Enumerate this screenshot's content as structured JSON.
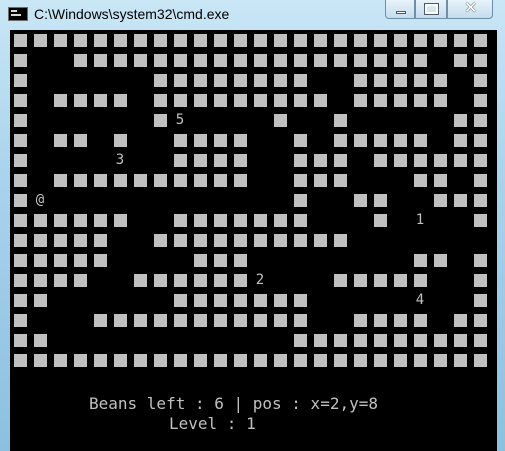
{
  "window": {
    "title": "C:\\Windows\\system32\\cmd.exe",
    "icon": "console-icon",
    "controls": [
      "minimize-icon",
      "maximize-icon",
      "close-icon"
    ]
  },
  "game": {
    "maze_rows": [
      "########################",
      "#  ################## ##",
      "#      ########  ##### ##",
      "# #### ######### ##### ##",
      "#      #5    #  #     ##",
      "# ## #  ####  # ##### ##",
      "#    3  ####  ### ########",
      "# ##########  ###   ## ##",
      "#@            #  ##  ####",
      "######  #######   # 1  # #",
      "#####  ##########        #",
      "#####    ###        ## ##",
      "####  ######2   #####  ##",
      "##      #######     4  ##",
      "#   ###########  #### ###",
      "##            ###########",
      "########################"
    ],
    "player_symbol": "@",
    "bean_labels": [
      "5",
      "3",
      "1",
      "2",
      "4"
    ]
  },
  "status": {
    "line": "Beans left : 6 | pos : x=2,y=8",
    "level": "Level : 1"
  },
  "colors": {
    "console_bg": "#000000",
    "console_fg": "#c0c0c0"
  }
}
